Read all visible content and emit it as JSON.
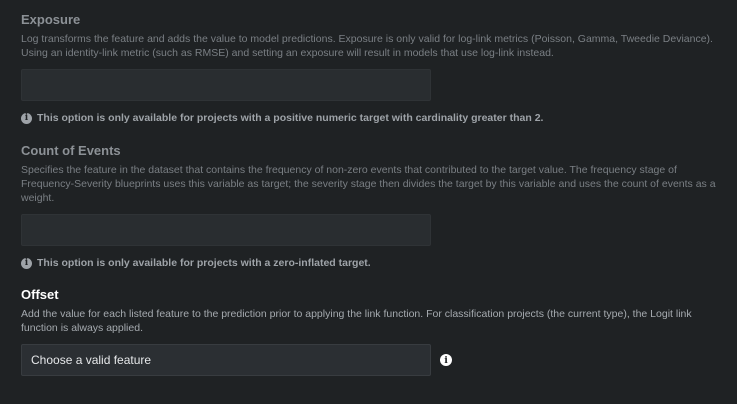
{
  "exposure": {
    "title": "Exposure",
    "description": "Log transforms the feature and adds the value to model predictions. Exposure is only valid for log-link metrics (Poisson, Gamma, Tweedie Deviance). Using an identity-link metric (such as RMSE) and setting an exposure will result in models that use log-link instead.",
    "value": "",
    "note": "This option is only available for projects with a positive numeric target with cardinality greater than 2."
  },
  "count_of_events": {
    "title": "Count of Events",
    "description": "Specifies the feature in the dataset that contains the frequency of non-zero events that contributed to the target value. The frequency stage of Frequency-Severity blueprints uses this variable as target; the severity stage then divides the target by this variable and uses the count of events as a weight.",
    "value": "",
    "note": "This option is only available for projects with a zero-inflated target."
  },
  "offset": {
    "title": "Offset",
    "description": "Add the value for each listed feature to the prediction prior to applying the link function. For classification projects (the current type), the Logit link function is always applied.",
    "value": "Choose a valid feature"
  },
  "icons": {
    "info": "info-icon"
  }
}
